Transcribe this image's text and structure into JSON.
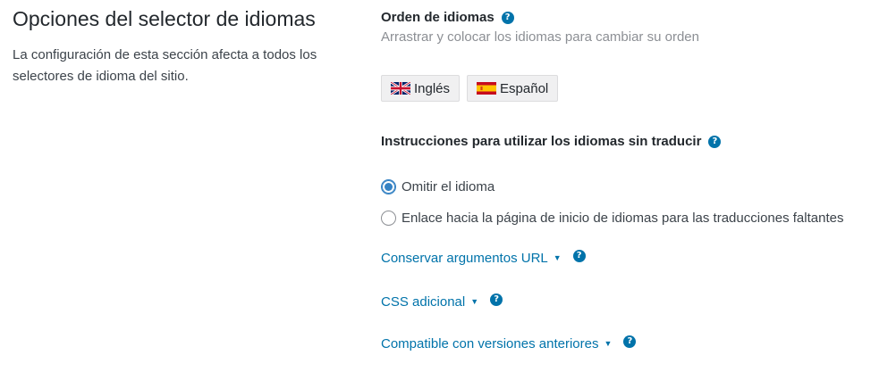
{
  "section": {
    "title": "Opciones del selector de idiomas",
    "description": "La configuración de esta sección afecta a todos los selectores de idioma del sitio."
  },
  "language_order": {
    "heading": "Orden de idiomas",
    "hint": "Arrastrar y colocar los idiomas para cambiar su orden",
    "languages": [
      {
        "label": "Inglés",
        "flag": "uk-flag-icon"
      },
      {
        "label": "Español",
        "flag": "spain-flag-icon"
      }
    ]
  },
  "untranslated": {
    "heading": "Instrucciones para utilizar los idiomas sin traducir",
    "options": [
      {
        "label": "Omitir el idioma",
        "checked": true
      },
      {
        "label": "Enlace hacia la página de inicio de idiomas para las traducciones faltantes",
        "checked": false
      }
    ]
  },
  "toggles": [
    {
      "label": "Conservar argumentos URL"
    },
    {
      "label": "CSS adicional"
    },
    {
      "label": "Compatible con versiones anteriores"
    }
  ],
  "icons": {
    "help": "?",
    "caret": "▼"
  },
  "colors": {
    "link": "#0073aa",
    "help_icon": "#0073aa",
    "radio_checked": "#3582c4",
    "hint_text": "#8c8f94"
  }
}
